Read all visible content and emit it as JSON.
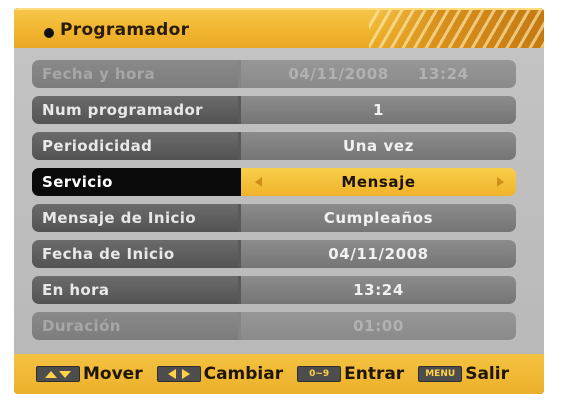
{
  "header": {
    "title": "Programador"
  },
  "rows": [
    {
      "label": "Fecha y hora",
      "value": "04/11/2008     13:24",
      "state": "disabled"
    },
    {
      "label": "Num programador",
      "value": "1",
      "state": "normal"
    },
    {
      "label": "Periodicidad",
      "value": "Una vez",
      "state": "normal"
    },
    {
      "label": "Servicio",
      "value": "Mensaje",
      "state": "selected"
    },
    {
      "label": "Mensaje de Inicio",
      "value": "Cumpleaños",
      "state": "normal"
    },
    {
      "label": "Fecha de Inicio",
      "value": "04/11/2008",
      "state": "normal"
    },
    {
      "label": "En hora",
      "value": "13:24",
      "state": "normal"
    },
    {
      "label": "Duración",
      "value": "01:00",
      "state": "disabled"
    }
  ],
  "footer": {
    "move_label": "Mover",
    "change_label": "Cambiar",
    "digits_key": "0~9",
    "enter_label": "Entrar",
    "menu_key": "MENU",
    "exit_label": "Salir"
  },
  "colors": {
    "accent_yellow": "#f0b22a",
    "panel_gray": "#bdbdbd",
    "selected_label_bg": "#0a0a0a"
  }
}
